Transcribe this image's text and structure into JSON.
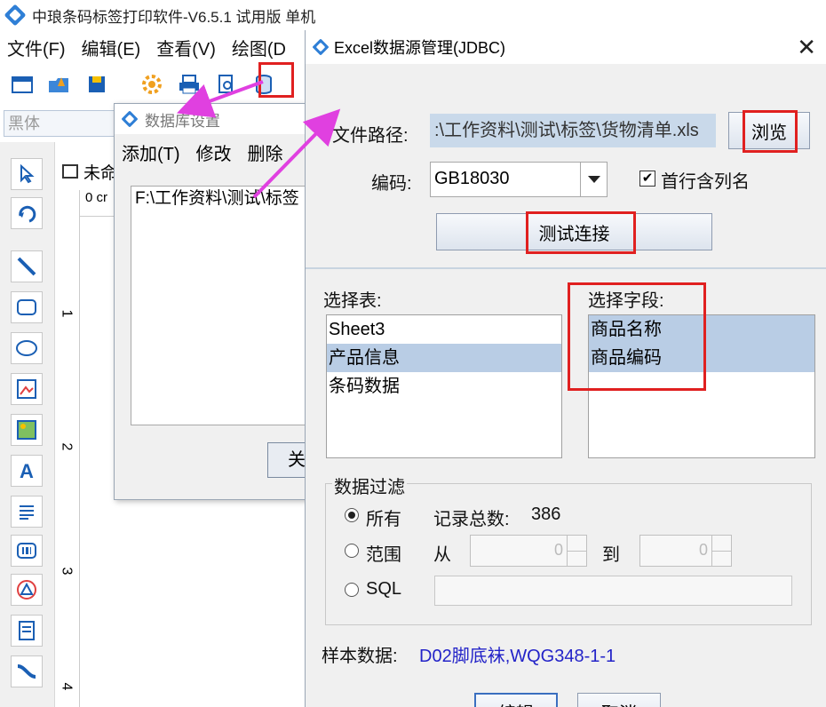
{
  "app": {
    "title": "中琅条码标签打印软件-V6.5.1 试用版 单机",
    "menu": [
      "文件(F)",
      "编辑(E)",
      "查看(V)",
      "绘图(D"
    ],
    "font_placeholder": "黑体",
    "canvas_tab": "未命",
    "ruler_h": "0 cr",
    "ruler_v": [
      "1",
      "2",
      "3",
      "4"
    ]
  },
  "db_window": {
    "title": "数据库设置",
    "menu": [
      "添加(T)",
      "修改",
      "删除"
    ],
    "items": [
      "F:\\工作资料\\测试\\标签"
    ],
    "close_label": "关"
  },
  "dialog": {
    "title": "Excel数据源管理(JDBC)",
    "file_path_label": "文件路径:",
    "file_path_value": ":\\工作资料\\测试\\标签\\货物清单.xls",
    "browse_label": "浏览",
    "encoding_label": "编码:",
    "encoding_value": "GB18030",
    "first_row_header_label": "首行含列名",
    "first_row_header_checked": true,
    "test_connection_label": "测试连接",
    "select_table_label": "选择表:",
    "tables": [
      "Sheet3",
      "产品信息",
      "条码数据"
    ],
    "selected_table_index": 1,
    "select_field_label": "选择字段:",
    "fields": [
      "商品名称",
      "商品编码"
    ],
    "filter_group_label": "数据过滤",
    "filter_all_label": "所有",
    "record_total_label": "记录总数:",
    "record_total_value": "386",
    "filter_range_label": "范围",
    "from_label": "从",
    "from_value": "0",
    "to_label": "到",
    "to_value": "0",
    "filter_sql_label": "SQL",
    "sql_value": "",
    "sample_label": "样本数据:",
    "sample_value": "D02脚底袜,WQG348-1-1",
    "edit_label": "编辑",
    "cancel_label": "取消"
  },
  "colors": {
    "highlight_red": "#e02020",
    "arrow_magenta": "#e040e0",
    "selection": "#b9cde5",
    "sample_text": "#2323c8"
  }
}
